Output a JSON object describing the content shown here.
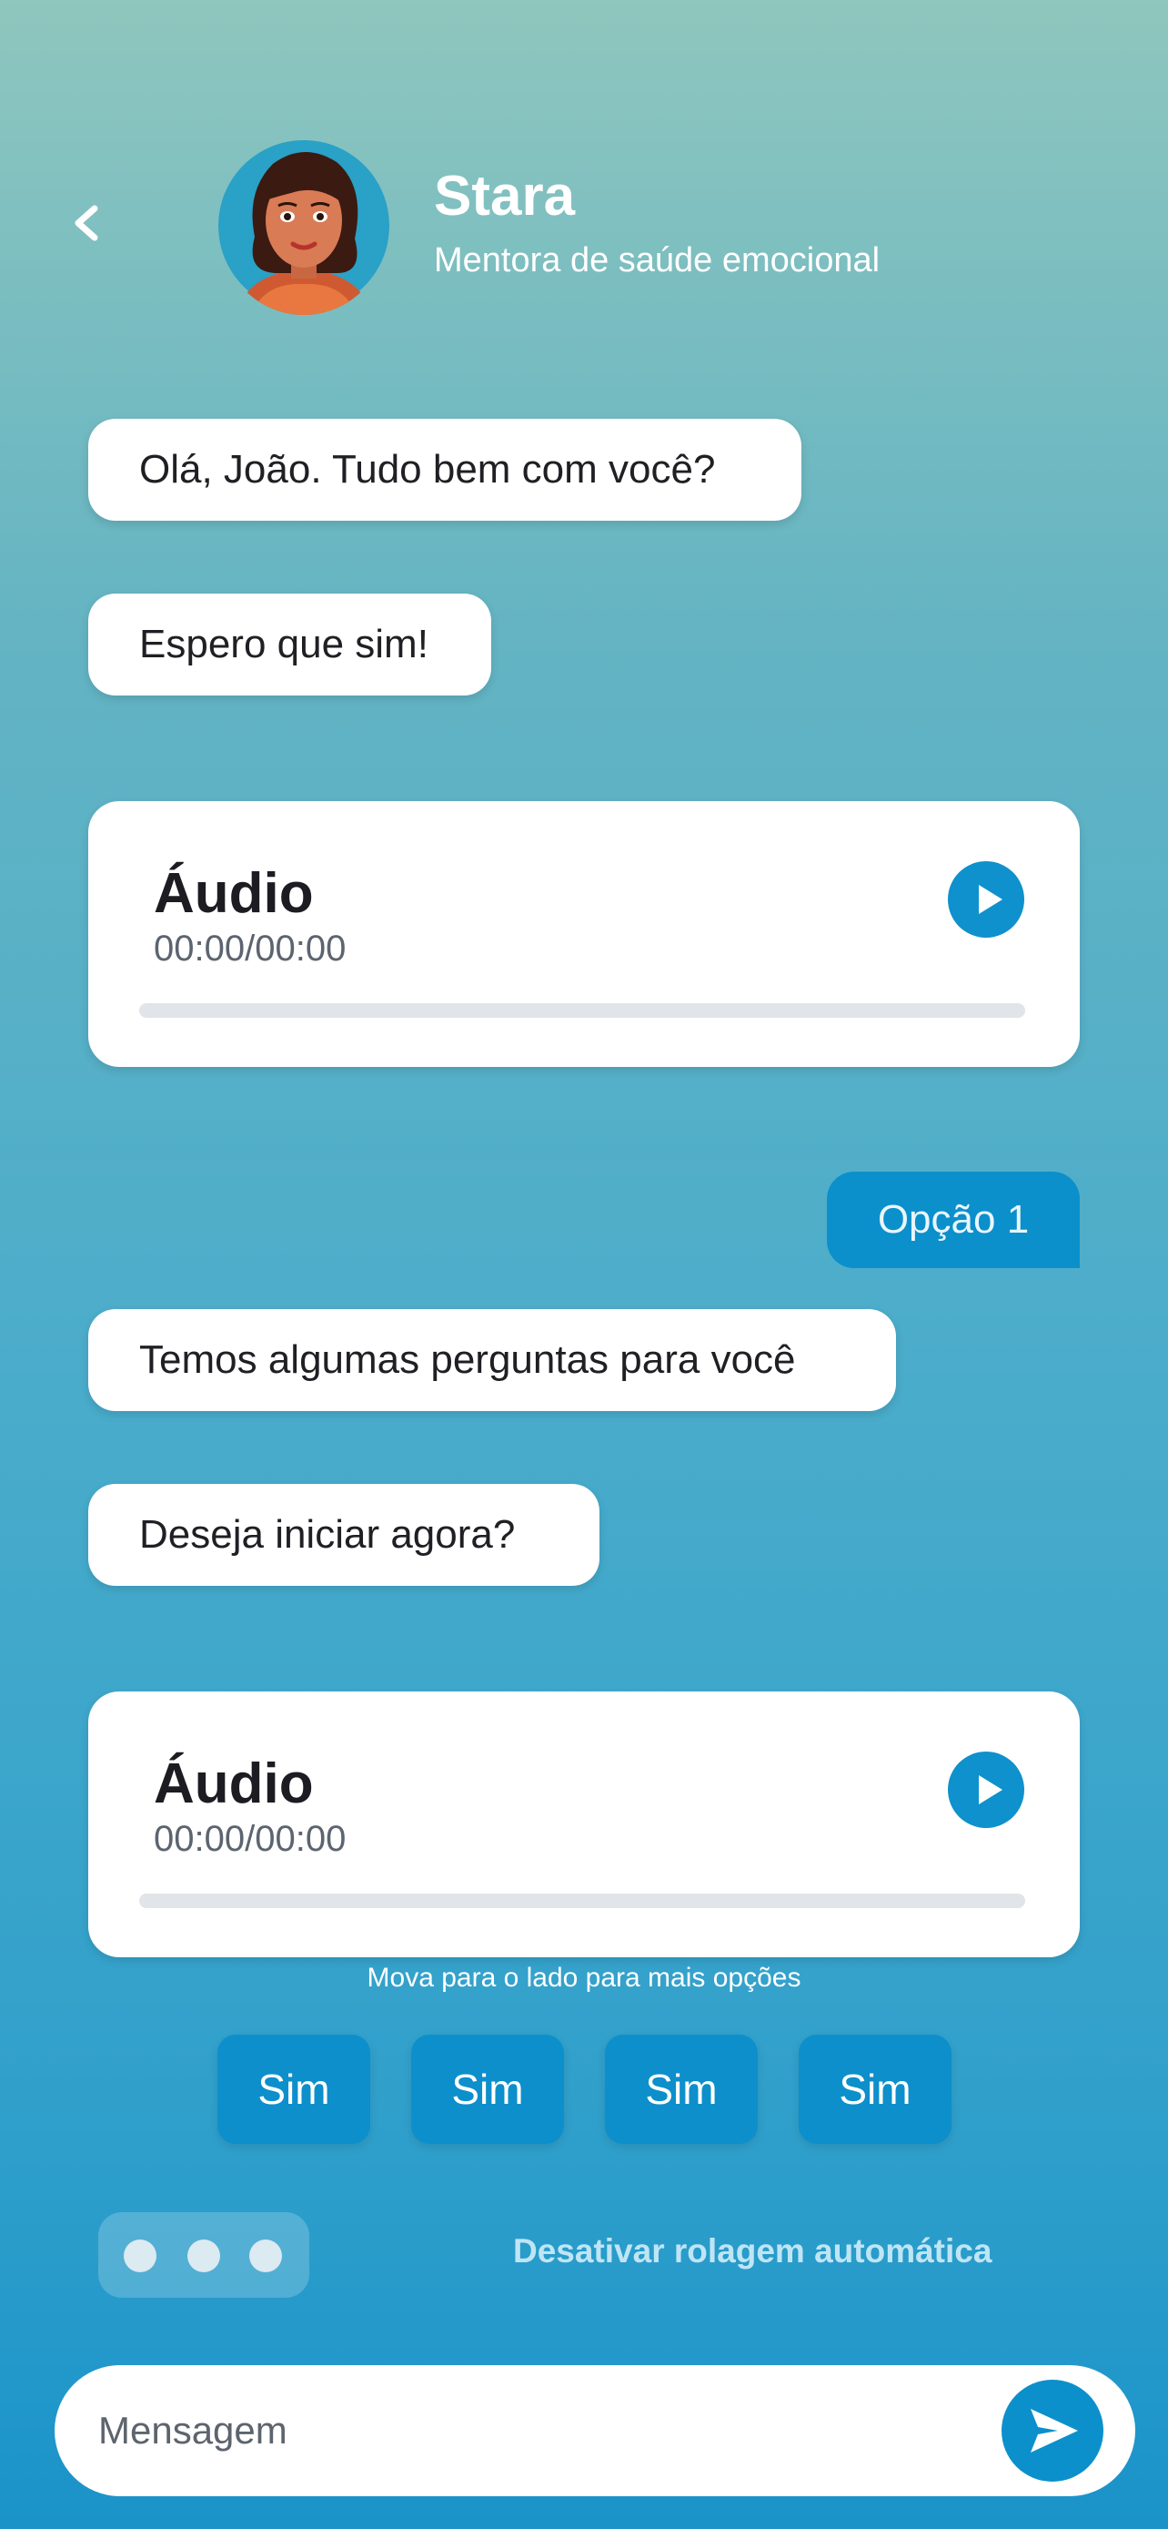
{
  "header": {
    "back_icon": "chevron-left-icon",
    "avatar_icon": "mentor-avatar-illustration",
    "title": "Stara",
    "subtitle": "Mentora de saúde emocional"
  },
  "messages": {
    "bot_1": "Olá, João. Tudo bem com você?",
    "bot_2": "Espero que sim!",
    "audio_1": {
      "title": "Áudio",
      "time": "00:00/00:00",
      "progress": 0,
      "icon": "play-icon"
    },
    "user_1": "Opção 1",
    "bot_3": "Temos algumas perguntas para você",
    "bot_4": "Deseja iniciar agora?",
    "audio_2": {
      "title": "Áudio",
      "time": "00:00/00:00",
      "progress": 0,
      "icon": "play-icon"
    }
  },
  "quick_replies": {
    "hint": "Mova para o lado para mais opções",
    "options": [
      "Sim",
      "Sim",
      "Sim",
      "Sim"
    ]
  },
  "footer": {
    "typing_indicator_icon": "typing-dots-icon",
    "autoscroll_label": "Desativar rolagem automática",
    "input_placeholder": "Mensagem",
    "send_icon": "send-icon"
  },
  "colors": {
    "accent": "#0b90cb",
    "bubble": "#ffffff",
    "text": "#1f1f24",
    "gradient_top": "#8fc6be",
    "gradient_bottom": "#1a93c9"
  }
}
